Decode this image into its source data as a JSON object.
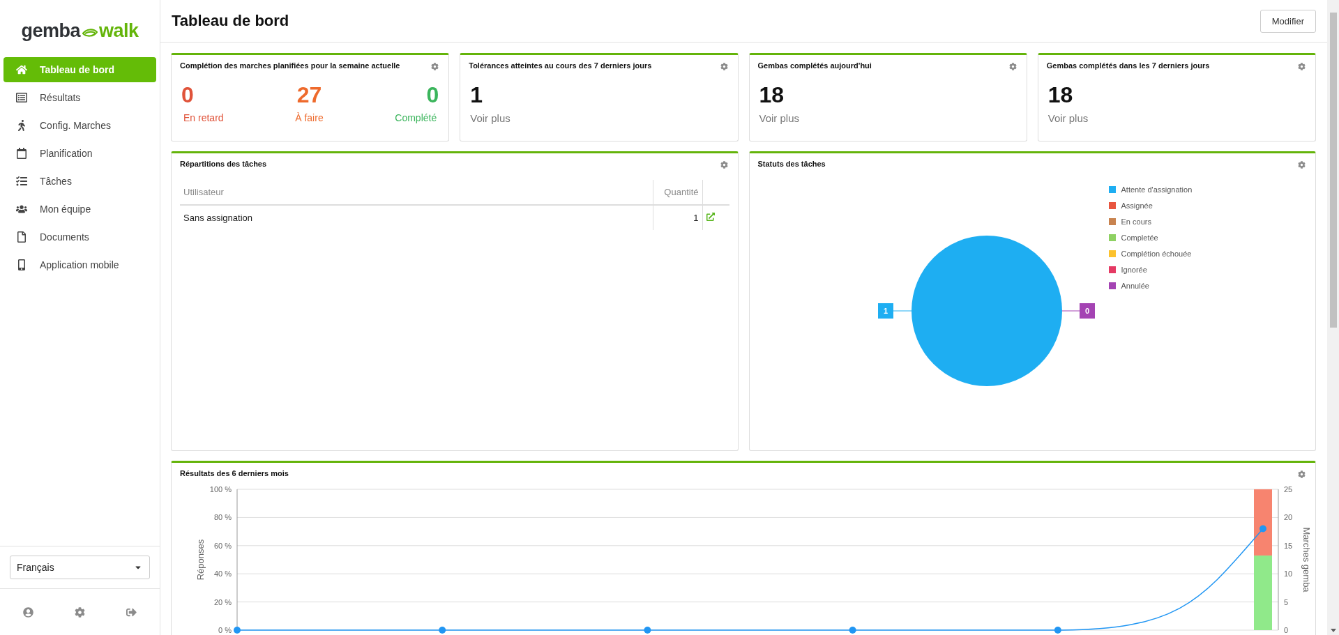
{
  "sidebar": {
    "logo": {
      "first": "gemba",
      "second": "walk"
    },
    "items": [
      {
        "label": "Tableau de bord",
        "selected": true
      },
      {
        "label": "Résultats",
        "selected": false
      },
      {
        "label": "Config. Marches",
        "selected": false
      },
      {
        "label": "Planification",
        "selected": false
      },
      {
        "label": "Tâches",
        "selected": false
      },
      {
        "label": "Mon équipe",
        "selected": false
      },
      {
        "label": "Documents",
        "selected": false
      },
      {
        "label": "Application mobile",
        "selected": false
      }
    ],
    "language": "Français"
  },
  "header": {
    "title": "Tableau de bord",
    "edit_button": "Modifier"
  },
  "completion_card": {
    "title": "Complétion des marches planifiées pour la semaine actuelle",
    "stats": [
      {
        "value": "0",
        "label": "En retard",
        "color": "#e0533a"
      },
      {
        "value": "27",
        "label": "À faire",
        "color": "#ee6a2c"
      },
      {
        "value": "0",
        "label": "Complété",
        "color": "#3bb55c"
      }
    ]
  },
  "stat_cards": [
    {
      "title": "Tolérances atteintes au cours des 7 derniers jours",
      "value": "1",
      "link": "Voir plus"
    },
    {
      "title": "Gembas complétés aujourd'hui",
      "value": "18",
      "link": "Voir plus"
    },
    {
      "title": "Gembas complétés dans les 7 derniers jours",
      "value": "18",
      "link": "Voir plus"
    }
  ],
  "task_distribution": {
    "title": "Répartitions des tâches",
    "columns": [
      "Utilisateur",
      "Quantité"
    ],
    "rows": [
      {
        "user": "Sans assignation",
        "quantity": "1"
      }
    ]
  },
  "task_status": {
    "title": "Statuts des tâches",
    "chart_data": {
      "type": "pie",
      "categories": [
        "Attente d'assignation",
        "Assignée",
        "En cours",
        "Completée",
        "Complétion échouée",
        "Ignorée",
        "Annulée"
      ],
      "values": [
        1,
        0,
        0,
        0,
        0,
        0,
        0
      ],
      "colors": [
        "#1eaef2",
        "#e8553f",
        "#c8834f",
        "#8ed162",
        "#fcc22d",
        "#e53a64",
        "#a443b3"
      ],
      "value_labels": [
        "1",
        null,
        null,
        null,
        null,
        null,
        "0"
      ]
    }
  },
  "results": {
    "title": "Résultats des 6 derniers mois",
    "chart_data": {
      "type": "bar",
      "stacked": true,
      "ylabel": "Réponses",
      "ylim": [
        0,
        100
      ],
      "yticks": [
        {
          "value": 0,
          "label": "0 %"
        },
        {
          "value": 20,
          "label": "20 %"
        },
        {
          "value": 40,
          "label": "40 %"
        },
        {
          "value": 60,
          "label": "60 %"
        },
        {
          "value": 80,
          "label": "80 %"
        },
        {
          "value": 100,
          "label": "100 %"
        }
      ],
      "y2label": "Marches gemba",
      "y2lim": [
        0,
        25
      ],
      "y2ticks": [
        0,
        5,
        10,
        15,
        20,
        25
      ],
      "grid": true,
      "series": [
        {
          "type": "bar",
          "color": "#90e98a",
          "values": [
            null,
            null,
            null,
            null,
            null,
            53
          ]
        },
        {
          "type": "bar",
          "color": "#f7846f",
          "values": [
            null,
            null,
            null,
            null,
            null,
            47
          ]
        },
        {
          "type": "line",
          "color": "#2196f3",
          "marker": "circle",
          "values": [
            0,
            0,
            0,
            0,
            0,
            72
          ]
        }
      ]
    }
  }
}
